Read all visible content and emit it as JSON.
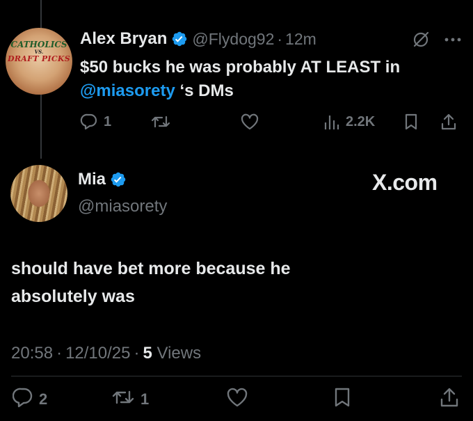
{
  "parent": {
    "avatar_logo": {
      "line1": "CATHOLICS",
      "line2": "VS.",
      "line3": "DRAFT PICKS"
    },
    "name": "Alex Bryan",
    "handle": "@Flydog92",
    "dot": "·",
    "time": "12m",
    "text_line1": "$50 bucks he was probably AT LEAST in",
    "mention": "@miasorety",
    "text_line2_suffix": " ‘s DMs",
    "actions": {
      "replies": "1",
      "views": "2.2K"
    },
    "icons": [
      "reply-icon",
      "retweet-icon",
      "like-icon",
      "views-icon",
      "bookmark-icon",
      "share-icon",
      "grok-icon",
      "more-icon",
      "verified-icon"
    ]
  },
  "tweet": {
    "name": "Mia",
    "handle": "@miasorety",
    "badge_text": "X.com",
    "text_line1": "should have bet more because he",
    "text_line2": "absolutely was",
    "meta": {
      "time": "20:58",
      "date": "12/10/25",
      "views_count": "5",
      "views_label": "Views",
      "sep": "·"
    },
    "actions": {
      "replies": "2",
      "retweets": "1"
    }
  },
  "colors": {
    "background": "#000000",
    "text": "#e7e9ea",
    "muted": "#71767b",
    "accent": "#1d9bf0"
  }
}
